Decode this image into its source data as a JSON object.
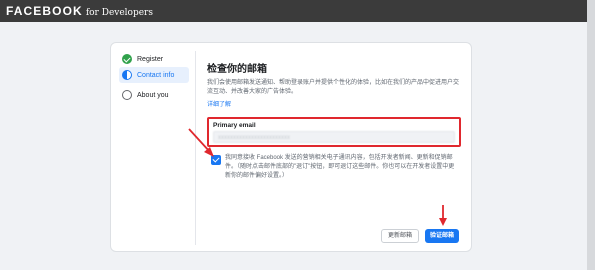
{
  "header": {
    "brand": "FACEBOOK",
    "brand_sub": "for Developers"
  },
  "steps": [
    {
      "label": "Register",
      "state": "done"
    },
    {
      "label": "Contact info",
      "state": "current"
    },
    {
      "label": "About you",
      "state": "todo"
    }
  ],
  "main": {
    "title": "检查你的邮箱",
    "description": "我们会使用邮箱发送通知、帮助登录账户并提供个性化的体验，比如在我们的产品中促进用户交流互动、并改善大家的广告体验。",
    "learn_more": "详细了解"
  },
  "email": {
    "label": "Primary email",
    "value": "xxxxxxxxxxxxxxxxxxxxxxxx"
  },
  "consent": {
    "checked": true,
    "text": "我同意接收 Facebook 发送的营销相关电子通讯内容，包括开发者新闻、更新和促销邮件。（随时点击邮件底部的\"退订\"按钮，即可退订这些邮件。你也可以在开发者设置中更新你的邮件偏好设置。）"
  },
  "buttons": {
    "change_email": "更新邮箱",
    "verify_email": "验证邮箱"
  },
  "colors": {
    "accent": "#1877f2",
    "annotation": "#e0282e",
    "success": "#31a24c"
  }
}
